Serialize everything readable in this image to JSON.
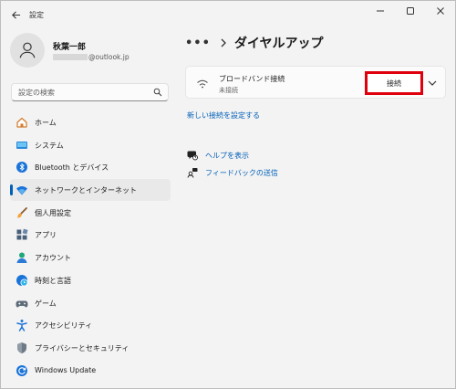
{
  "window": {
    "title": "設定",
    "back_icon": "back-arrow-icon",
    "controls": [
      "minimize-icon",
      "maximize-icon",
      "close-icon"
    ]
  },
  "profile": {
    "name": "秋葉一郎",
    "email_suffix": "@outlook.jp"
  },
  "search": {
    "placeholder": "設定の検索"
  },
  "nav": {
    "items": [
      {
        "label": "ホーム",
        "icon": "home-icon"
      },
      {
        "label": "システム",
        "icon": "system-monitor-icon"
      },
      {
        "label": "Bluetooth とデバイス",
        "icon": "bluetooth-icon"
      },
      {
        "label": "ネットワークとインターネット",
        "icon": "wifi-icon",
        "active": true
      },
      {
        "label": "個人用設定",
        "icon": "paintbrush-icon"
      },
      {
        "label": "アプリ",
        "icon": "apps-icon"
      },
      {
        "label": "アカウント",
        "icon": "account-icon"
      },
      {
        "label": "時刻と言語",
        "icon": "clock-globe-icon"
      },
      {
        "label": "ゲーム",
        "icon": "gamepad-icon"
      },
      {
        "label": "アクセシビリティ",
        "icon": "accessibility-icon"
      },
      {
        "label": "プライバシーとセキュリティ",
        "icon": "shield-icon"
      },
      {
        "label": "Windows Update",
        "icon": "windows-update-icon"
      }
    ],
    "accent_color": "#005fb8"
  },
  "main": {
    "breadcrumb_more": "•••",
    "title": "ダイヤルアップ",
    "connection": {
      "name": "ブロードバンド接続",
      "status": "未接続",
      "connect_label": "接続",
      "highlight_color": "#e0000d"
    },
    "new_connection_link": "新しい接続を設定する",
    "help_link": "ヘルプを表示",
    "feedback_link": "フィードバックの送信"
  }
}
